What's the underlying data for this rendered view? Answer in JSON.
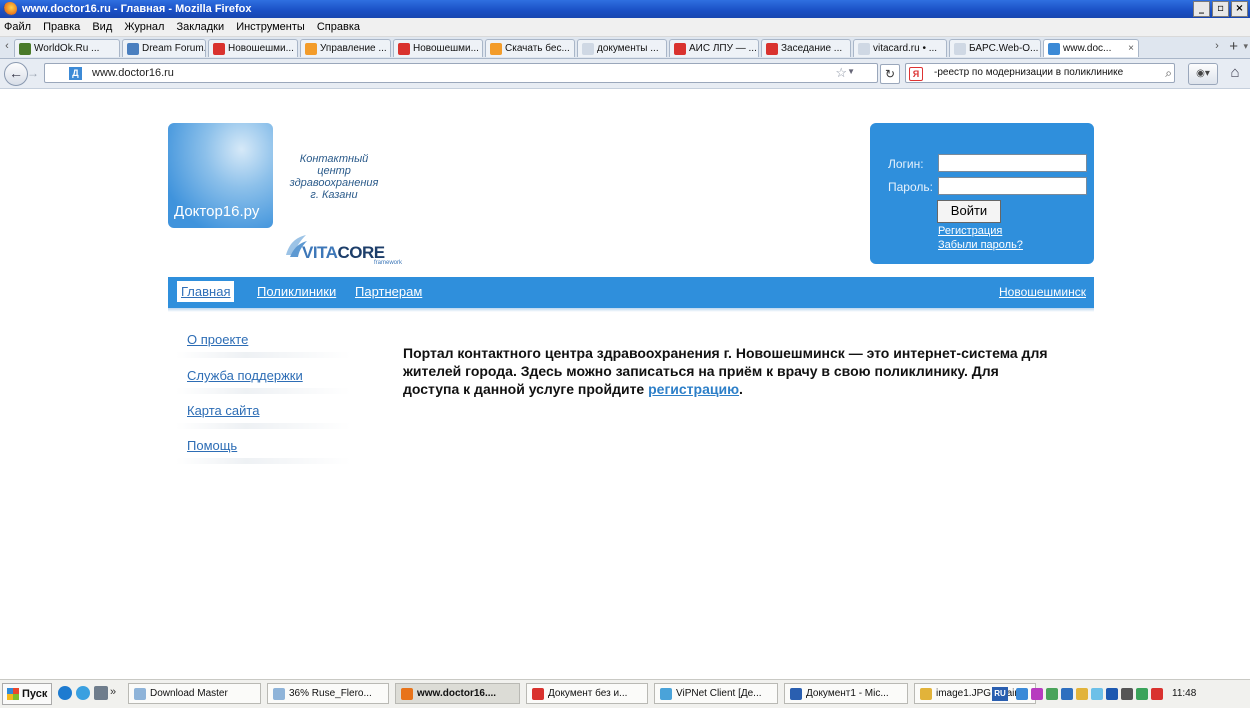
{
  "window": {
    "title": "www.doctor16.ru - Главная - Mozilla Firefox",
    "controls": [
      "_",
      "ř",
      "x"
    ]
  },
  "menubar": [
    "Файл",
    "Правка",
    "Вид",
    "Журнал",
    "Закладки",
    "Инструменты",
    "Справка"
  ],
  "tabs": [
    {
      "label": "WorldOk.Ru ...",
      "color": "#4a7a2a"
    },
    {
      "label": "Dream Forum...",
      "color": "#4a7fbf"
    },
    {
      "label": "Новошешми...",
      "color": "#d9322e"
    },
    {
      "label": "Управление ...",
      "color": "#f39c2a"
    },
    {
      "label": "Новошешми...",
      "color": "#d9322e"
    },
    {
      "label": "Скачать бес...",
      "color": "#f39c2a"
    },
    {
      "label": "документы ...",
      "color": "#cfd8e4"
    },
    {
      "label": "АИС ЛПУ — ...",
      "color": "#d9322e"
    },
    {
      "label": "Заседание ...",
      "color": "#d9322e"
    },
    {
      "label": "vitacard.ru • ...",
      "color": "#cfd8e4"
    },
    {
      "label": "БАРС.Web-О...",
      "color": "#cfd8e4"
    },
    {
      "label": "www.doc...",
      "color": "#3c8ad6",
      "active": true
    }
  ],
  "navbar": {
    "url": "www.doctor16.ru",
    "search_text": "-реестр по модернизации в поликлинике"
  },
  "site": {
    "logo_text": "Доктор16.ру",
    "tagline": [
      "Контактный",
      "центр",
      "здравоохранения",
      "г. Казани"
    ],
    "vitacore_a": "VITA",
    "vitacore_b": "CORE",
    "vitacore_sub": "framework",
    "login": {
      "login_label": "Логин:",
      "password_label": "Пароль:",
      "login_value": "",
      "password_value": "",
      "submit": "Войти",
      "register": "Регистрация",
      "forgot": "Забыли пароль?"
    },
    "nav": {
      "home": "Главная",
      "clinics": "Поликлиники",
      "partners": "Партнерам",
      "city": "Новошешминск"
    },
    "side": [
      "О проекте",
      "Служба поддержки",
      "Карта сайта",
      "Помощь"
    ],
    "intro_text": "Портал контактного центра здравоохранения г. Новошешминск — это интернет-система для жителей города. Здесь можно записаться на приём к врачу в свою поликлинику. Для доступа к данной услуге пройдите ",
    "intro_link": "регистрацию",
    "intro_end": "."
  },
  "taskbar": {
    "start": "Пуск",
    "items": [
      {
        "label": "Download Master",
        "color": "#8fb4d9"
      },
      {
        "label": "36% Ruse_Flero...",
        "color": "#8fb4d9"
      },
      {
        "label": "www.doctor16....",
        "color": "#e8731a",
        "active": true
      },
      {
        "label": "Документ без и...",
        "color": "#d9322e"
      },
      {
        "label": "ViPNet Client [Де...",
        "color": "#4aa3d9"
      },
      {
        "label": "Документ1 - Mic...",
        "color": "#2a5fb0"
      },
      {
        "label": "image1.JPG - Paint",
        "color": "#e2b33a"
      }
    ],
    "lang": "RU",
    "clock": "11:48"
  }
}
